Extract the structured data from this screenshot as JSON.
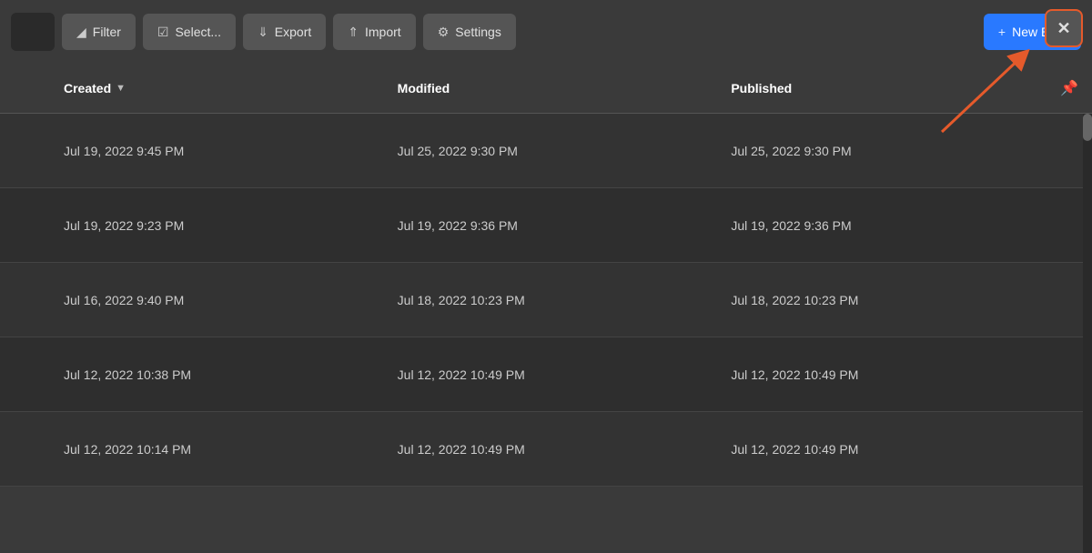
{
  "toolbar": {
    "filter_label": "Filter",
    "select_label": "Select...",
    "export_label": "Export",
    "import_label": "Import",
    "settings_label": "Settings",
    "new_blog_label": "New Blog"
  },
  "table": {
    "headers": {
      "created": "Created",
      "modified": "Modified",
      "published": "Published"
    },
    "rows": [
      {
        "created": "Jul 19, 2022 9:45 PM",
        "modified": "Jul 25, 2022 9:30 PM",
        "published": "Jul 25, 2022 9:30 PM"
      },
      {
        "created": "Jul 19, 2022 9:23 PM",
        "modified": "Jul 19, 2022 9:36 PM",
        "published": "Jul 19, 2022 9:36 PM"
      },
      {
        "created": "Jul 16, 2022 9:40 PM",
        "modified": "Jul 18, 2022 10:23 PM",
        "published": "Jul 18, 2022 10:23 PM"
      },
      {
        "created": "Jul 12, 2022 10:38 PM",
        "modified": "Jul 12, 2022 10:49 PM",
        "published": "Jul 12, 2022 10:49 PM"
      },
      {
        "created": "Jul 12, 2022 10:14 PM",
        "modified": "Jul 12, 2022 10:49 PM",
        "published": "Jul 12, 2022 10:49 PM"
      }
    ]
  },
  "colors": {
    "accent_blue": "#2979ff",
    "accent_orange": "#e55a2b"
  }
}
